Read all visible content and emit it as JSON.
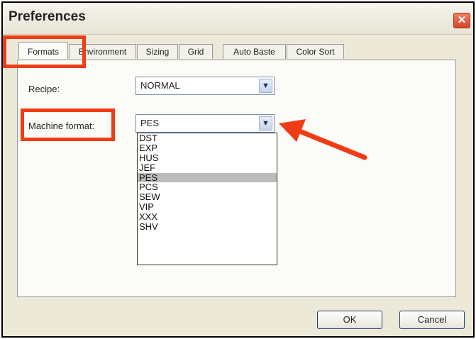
{
  "window": {
    "title": "Preferences",
    "close_symbol": "✕"
  },
  "tabs": [
    {
      "label": "Formats"
    },
    {
      "label": "Environment"
    },
    {
      "label": "Sizing"
    },
    {
      "label": "Grid"
    },
    {
      "label": "Auto Baste"
    },
    {
      "label": "Color Sort"
    }
  ],
  "form": {
    "recipe_label": "Recipe:",
    "recipe_value": "NORMAL",
    "machine_format_label": "Machine format:",
    "machine_format_value": "PES"
  },
  "machine_format_options": [
    "DST",
    "EXP",
    "HUS",
    "JEF",
    "PES",
    "PCS",
    "SEW",
    "VIP",
    "XXX",
    "SHV"
  ],
  "selected_option": "PES",
  "buttons": {
    "ok": "OK",
    "cancel": "Cancel"
  },
  "colors": {
    "annotation": "#f03c14",
    "selection": "#bcbcbc"
  },
  "icons": {
    "dropdown_arrow": "chevron-down-icon",
    "close": "close-icon",
    "pointer": "arrow-icon"
  }
}
